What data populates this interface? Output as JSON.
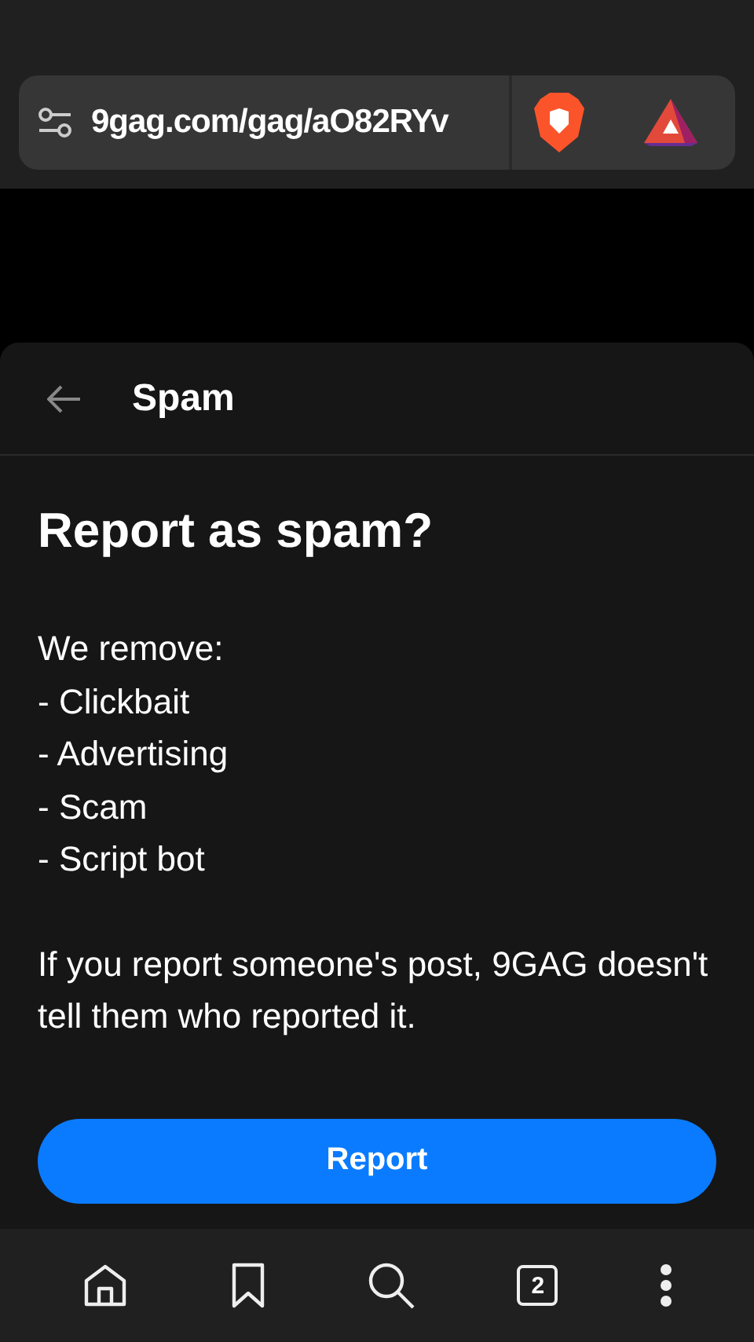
{
  "address_bar": {
    "url": "9gag.com/gag/aO82RYv"
  },
  "sheet": {
    "title": "Spam",
    "heading": "Report as spam?",
    "intro": "We remove:",
    "reasons": [
      "- Clickbait",
      "- Advertising",
      "- Scam",
      "- Script bot"
    ],
    "note": "If you report someone's post, 9GAG doesn't tell them who reported it.",
    "button": "Report"
  },
  "bottom_bar": {
    "tab_count": "2"
  }
}
